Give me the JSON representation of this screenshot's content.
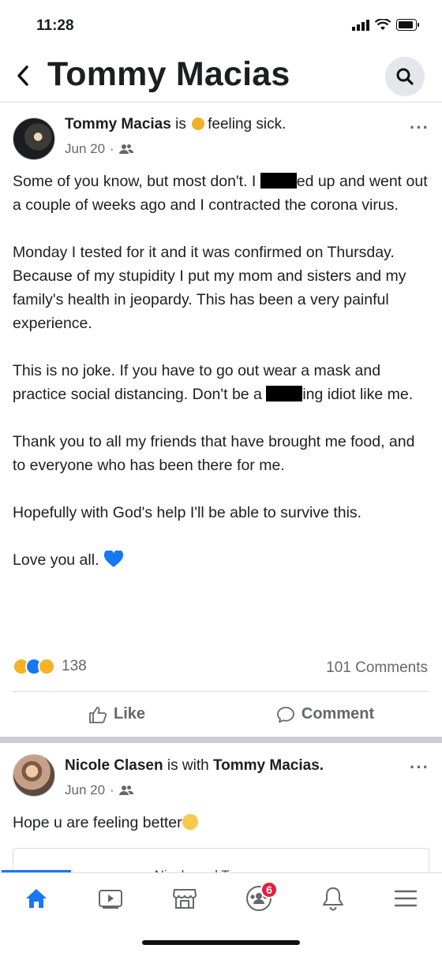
{
  "status_bar": {
    "time": "11:28"
  },
  "header": {
    "title": "Tommy Macias"
  },
  "post1": {
    "author": "Tommy Macias",
    "activity_prefix": " is ",
    "feeling": "feeling sick.",
    "date": "Jun 20",
    "dot": "·",
    "paragraphs": {
      "p1_a": "Some of you know, but most don't. I ",
      "p1_b": "ed up and went out a couple of weeks ago and I contracted the corona virus.",
      "p2": "Monday I tested for it and it was confirmed on Thursday. Because of my stupidity I put my mom and sisters and my family's health in jeopardy. This has been a very painful experience.",
      "p3_a": "This is no joke. If you have to go out wear a mask and practice social distancing. Don't be a ",
      "p3_b": "ing idiot like me.",
      "p4": "Thank you to all my friends that have brought me food, and to everyone who has been there for me.",
      "p5": "Hopefully with God's help I'll be able to survive this.",
      "p6": "Love you all."
    },
    "reaction_count": "138",
    "comments_count": "101 Comments",
    "actions": {
      "like": "Like",
      "comment": "Comment"
    }
  },
  "post2": {
    "author": "Nicole Clasen",
    "with_text": " is with ",
    "tagged": "Tommy Macias.",
    "date": "Jun 20",
    "dot": "·",
    "body": "Hope u are feeling better",
    "card_text": "Nicole and Tommy are"
  },
  "tab_bar": {
    "groups_badge": "6"
  },
  "colors": {
    "accent": "#1877f2",
    "badge": "#e41e3f",
    "heart": "#1877f2"
  }
}
